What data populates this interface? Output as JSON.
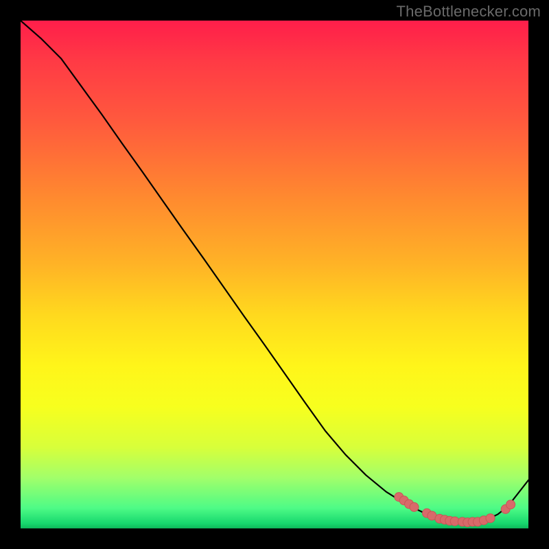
{
  "watermark": "TheBottlenecker.com",
  "colors": {
    "dot": "#d86a6a",
    "curve": "#000000",
    "bg_black": "#000000"
  },
  "chart_data": {
    "type": "line",
    "title": "",
    "xlabel": "",
    "ylabel": "",
    "x": [
      0.0,
      0.04,
      0.08,
      0.12,
      0.16,
      0.2,
      0.24,
      0.28,
      0.32,
      0.36,
      0.4,
      0.44,
      0.48,
      0.52,
      0.56,
      0.6,
      0.64,
      0.68,
      0.72,
      0.76,
      0.8,
      0.84,
      0.86,
      0.88,
      0.9,
      0.92,
      0.94,
      0.96,
      1.0
    ],
    "y": [
      1.0,
      0.965,
      0.925,
      0.87,
      0.815,
      0.758,
      0.702,
      0.645,
      0.588,
      0.532,
      0.475,
      0.418,
      0.362,
      0.305,
      0.248,
      0.192,
      0.145,
      0.105,
      0.072,
      0.047,
      0.028,
      0.017,
      0.013,
      0.012,
      0.013,
      0.018,
      0.028,
      0.044,
      0.095
    ],
    "data_points": [
      {
        "x": 0.745,
        "y": 0.062
      },
      {
        "x": 0.755,
        "y": 0.055
      },
      {
        "x": 0.765,
        "y": 0.048
      },
      {
        "x": 0.775,
        "y": 0.042
      },
      {
        "x": 0.8,
        "y": 0.03
      },
      {
        "x": 0.81,
        "y": 0.025
      },
      {
        "x": 0.825,
        "y": 0.019
      },
      {
        "x": 0.835,
        "y": 0.017
      },
      {
        "x": 0.845,
        "y": 0.015
      },
      {
        "x": 0.855,
        "y": 0.014
      },
      {
        "x": 0.87,
        "y": 0.013
      },
      {
        "x": 0.88,
        "y": 0.012
      },
      {
        "x": 0.89,
        "y": 0.013
      },
      {
        "x": 0.9,
        "y": 0.013
      },
      {
        "x": 0.912,
        "y": 0.016
      },
      {
        "x": 0.925,
        "y": 0.02
      },
      {
        "x": 0.955,
        "y": 0.038
      },
      {
        "x": 0.965,
        "y": 0.047
      }
    ],
    "xlim": [
      0,
      1
    ],
    "ylim": [
      0,
      1
    ]
  }
}
